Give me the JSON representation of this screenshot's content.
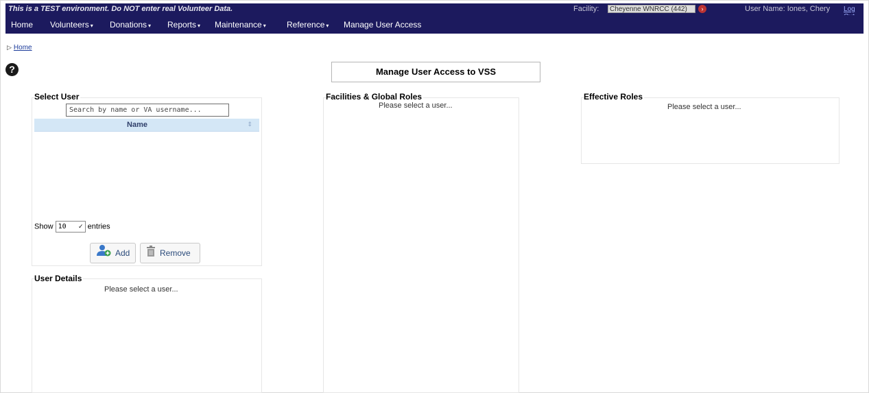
{
  "header": {
    "test_warning": "This is a TEST environment. Do NOT enter real Volunteer Data.",
    "facility_label": "Facility:",
    "facility_value": "Cheyenne WNRCC (442)",
    "username": "User Name: Iones, Chery",
    "logout": "Log Out"
  },
  "nav": {
    "items": [
      {
        "label": "Home",
        "has_menu": false
      },
      {
        "label": "Volunteers",
        "has_menu": true
      },
      {
        "label": "Donations",
        "has_menu": true
      },
      {
        "label": "Reports",
        "has_menu": true
      },
      {
        "label": "Maintenance",
        "has_menu": true
      },
      {
        "label": "Reference",
        "has_menu": true
      },
      {
        "label": "Manage User Access",
        "has_menu": false
      }
    ],
    "caret": "▾"
  },
  "breadcrumb": {
    "home": "Home"
  },
  "help_icon": "?",
  "page_title": "Manage User Access to VSS",
  "select_user": {
    "title": "Select User",
    "search_placeholder": "Search by name or VA username...",
    "column_name": "Name",
    "sort_icon": "⇕",
    "show_label": "Show",
    "entries_value": "10",
    "entries_label": "entries",
    "add_label": "Add",
    "remove_label": "Remove"
  },
  "user_details": {
    "title": "User Details",
    "placeholder": "Please select a user..."
  },
  "facilities_roles": {
    "title": "Facilities & Global Roles",
    "placeholder": "Please select a user..."
  },
  "effective_roles": {
    "title": "Effective Roles",
    "placeholder": "Please select a user..."
  },
  "colors": {
    "nav_bg": "#1c1a5e",
    "table_header_bg": "#d4e7f6"
  }
}
